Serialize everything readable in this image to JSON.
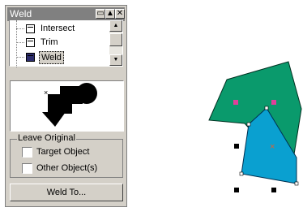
{
  "docker": {
    "title": "Weld",
    "buttons": {
      "minimize_glyph": "▭",
      "expand_glyph": "▲",
      "close_glyph": "✕"
    }
  },
  "command_list": {
    "items": [
      {
        "label": "Intersect",
        "icon": "intersect-icon",
        "selected": false
      },
      {
        "label": "Trim",
        "icon": "trim-icon",
        "selected": false
      },
      {
        "label": "Weld",
        "icon": "weld-icon",
        "selected": true
      }
    ],
    "scroll_up_glyph": "▲",
    "scroll_down_glyph": "▼"
  },
  "leave_original": {
    "title": "Leave Original",
    "target_object": {
      "label": "Target Object",
      "checked": false
    },
    "other_objects": {
      "label": "Other Object(s)",
      "checked": false
    }
  },
  "actions": {
    "weld_to_label": "Weld To..."
  },
  "colors": {
    "panel": "#d4d0c8",
    "title_bar": "#808080",
    "green_shape": "#0a9a6c",
    "blue_shape": "#0aa0d0",
    "handle_magenta": "#e0409a",
    "center_marker": "#e06030"
  }
}
